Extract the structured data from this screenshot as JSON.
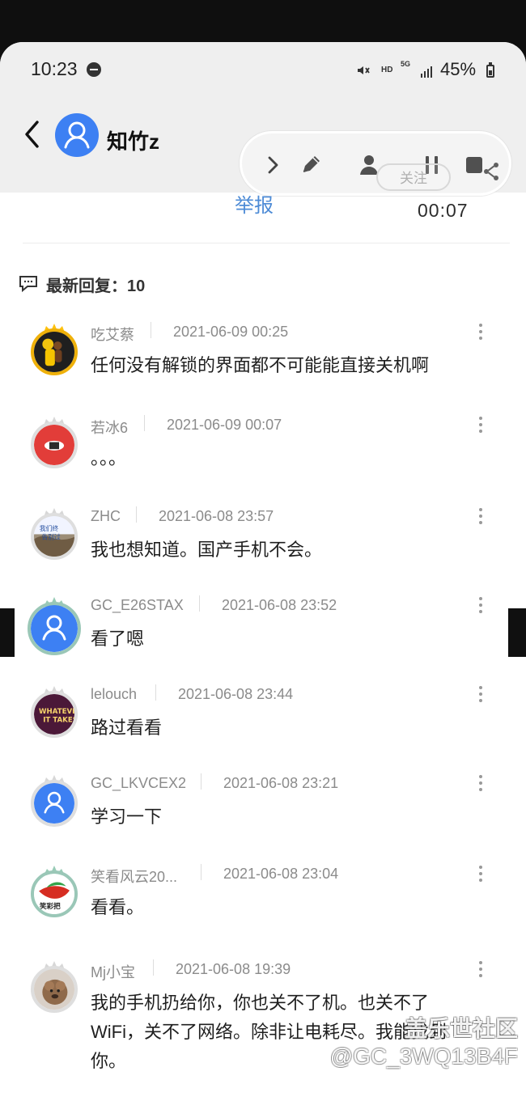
{
  "status_bar": {
    "time": "10:23",
    "hd": "HD",
    "network": "5G",
    "battery": "45%"
  },
  "header": {
    "profile_name": "知竹z",
    "follow_label": "关注",
    "record_time": "00:07",
    "report_label": "举报"
  },
  "replies": {
    "title": "最新回复：10",
    "items": [
      {
        "user": "吃艾蔡",
        "time": "2021-06-09 00:25",
        "text": "任何没有解锁的界面都不可能能直接关机啊"
      },
      {
        "user": "若冰6",
        "time": "2021-06-09 00:07",
        "text": "。。。"
      },
      {
        "user": "ZHC",
        "time": "2021-06-08 23:57",
        "text": "我也想知道。国产手机不会。"
      },
      {
        "user": "GC_E26STAX",
        "time": "2021-06-08 23:52",
        "text": "看了嗯"
      },
      {
        "user": "lelouch",
        "time": "2021-06-08 23:44",
        "text": "路过看看"
      },
      {
        "user": "GC_LKVCEX2",
        "time": "2021-06-08 23:21",
        "text": "学习一下"
      },
      {
        "user": "笑看风云20...",
        "time": "2021-06-08 23:04",
        "text": "看看。"
      },
      {
        "user": "Mj小宝",
        "time": "2021-06-08 19:39",
        "text": "我的手机扔给你，你也关不了机。也关不了WiFi，关不了网络。除非让电耗尽。我能找到你。"
      }
    ]
  },
  "watermark": {
    "title": "盖乐世社区",
    "handle": "@GC_3WQ13B4F"
  },
  "icons": {
    "back": "chevron-left-icon",
    "avatar": "user-icon",
    "chevron": "chevron-right-icon",
    "edit": "pencil-icon",
    "person": "person-icon",
    "pause": "pause-icon",
    "stop": "stop-icon",
    "share": "share-icon",
    "comment": "comment-icon",
    "more": "more-vertical-icon"
  }
}
